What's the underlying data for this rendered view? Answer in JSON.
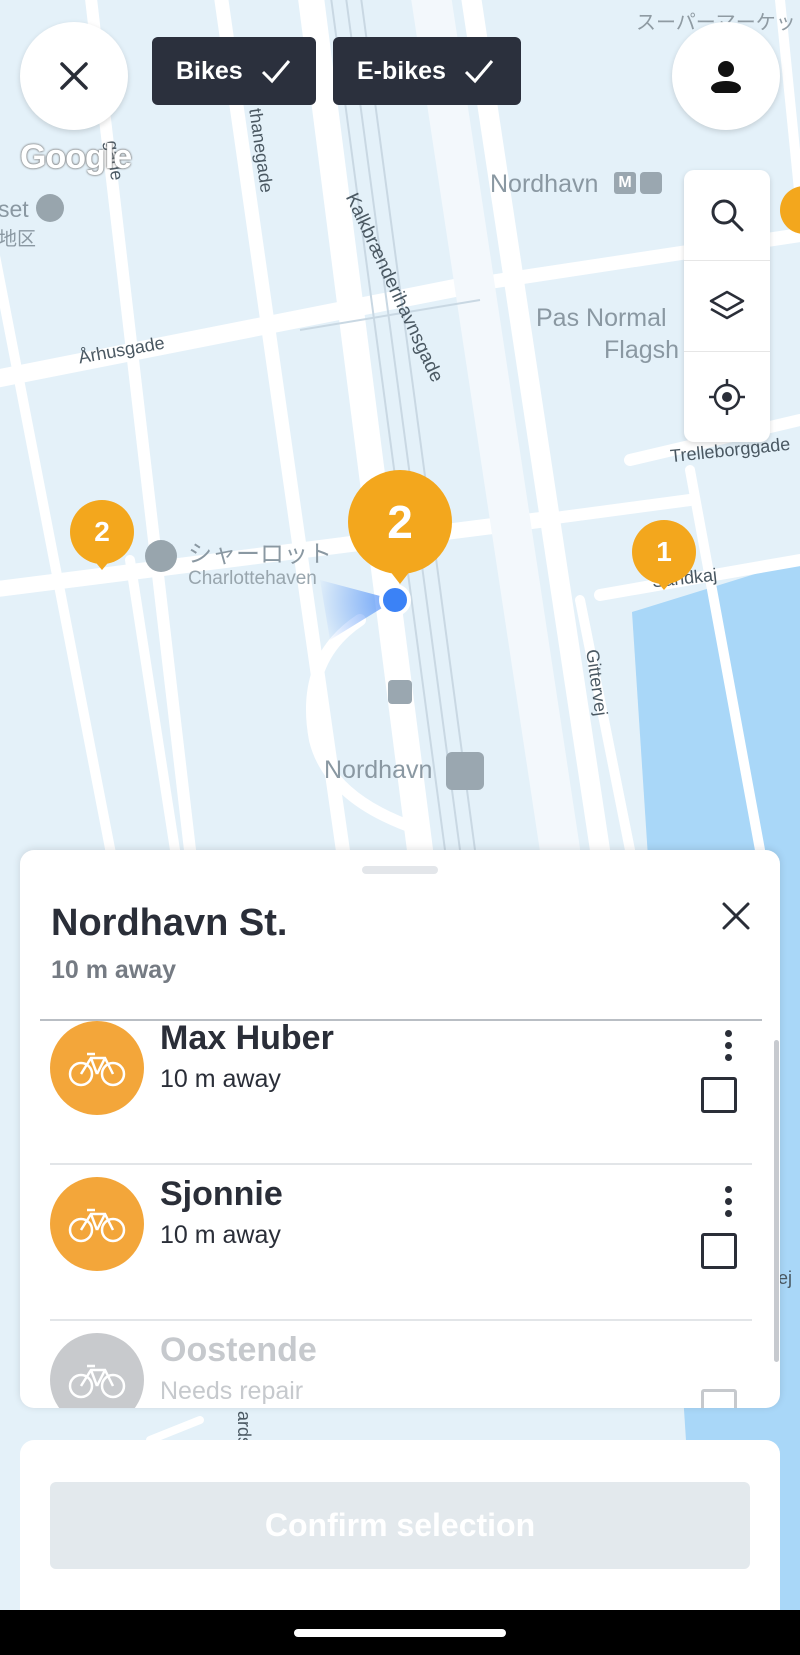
{
  "filters": {
    "bikes_label": "Bikes",
    "ebikes_label": "E-bikes"
  },
  "map": {
    "attribution": "Google",
    "labels": {
      "supermarket_jp": "スーパーマーケッ",
      "street_1": "gade",
      "street_2": "thanegade",
      "street_kalkbraenderi": "Kalkbrænderihavnsgade",
      "station_nordhavn_metro": "Nordhavn",
      "museum_left": "set",
      "museum_left_jp": "地区",
      "aarhusgade": "Århusgade",
      "pas_normal_1": "Pas Normal",
      "pas_normal_2": "Flagsh",
      "trelleborggade": "Trelleborggade",
      "charlotte_jp": "シャーロット",
      "charlottehaven": "Charlottehaven",
      "sandkaj": "Sandkaj",
      "gittervej": "Gittervej",
      "nordhavn_bus": "Nordhavn",
      "right_edge": "ej",
      "bottom_street": "ards"
    },
    "pins": {
      "pin_left": "2",
      "pin_center": "2",
      "pin_right": "1"
    },
    "metro_badge": "M"
  },
  "sheet": {
    "title": "Nordhavn St.",
    "subtitle": "10 m away",
    "bikes": [
      {
        "name": "Max Huber",
        "status": "10 m away"
      },
      {
        "name": "Sjonnie",
        "status": "10 m away"
      },
      {
        "name": "Oostende",
        "status": "Needs repair"
      }
    ]
  },
  "actions": {
    "confirm_label": "Confirm selection"
  },
  "colors": {
    "accent": "#f3a71d",
    "chip_bg": "#2b303d",
    "location_dot": "#3b82f6",
    "water": "#aad8fa"
  }
}
